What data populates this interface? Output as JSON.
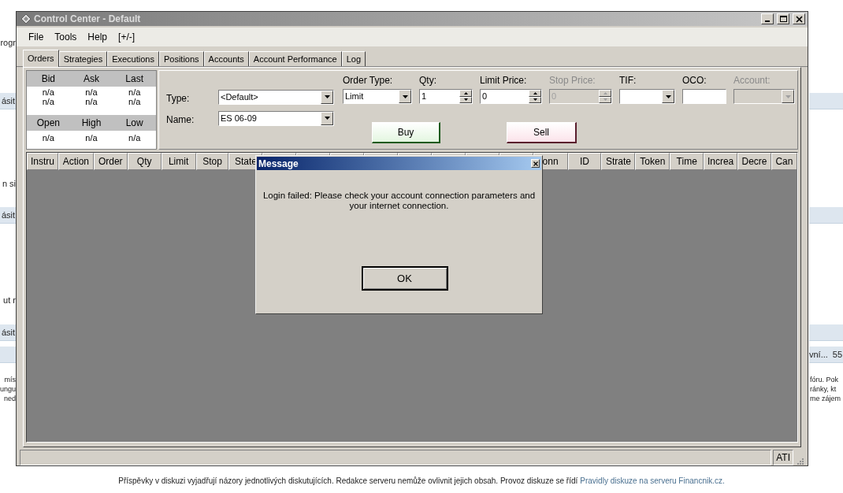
{
  "background_page": {
    "bars_left": [
      "ásit",
      "ásit",
      "ásit"
    ],
    "fragments_left": [
      "rogr",
      "n si",
      "ut r",
      "mís",
      "ungu",
      "ned"
    ],
    "bar_right": {
      "text": "vní...",
      "count": "55"
    },
    "fragments_right": [
      "fóru. Pok",
      "ránky, kt",
      "me zájem"
    ],
    "footer": {
      "text": "Příspěvky v diskuzi vyjadřují názory jednotlivých diskutujících. Redakce serveru nemůže ovlivnit jejich obsah. Provoz diskuze se řídí",
      "link": "Pravidly diskuze na serveru Financnik.cz."
    }
  },
  "window": {
    "title": "Control Center - Default"
  },
  "menu": [
    "File",
    "Tools",
    "Help",
    "[+/-]"
  ],
  "tabs": [
    {
      "label": "Orders",
      "selected": true
    },
    {
      "label": "Strategies",
      "selected": false
    },
    {
      "label": "Executions",
      "selected": false
    },
    {
      "label": "Positions",
      "selected": false
    },
    {
      "label": "Accounts",
      "selected": false
    },
    {
      "label": "Account Performance",
      "selected": false
    },
    {
      "label": "Log",
      "selected": false
    }
  ],
  "quote": [
    {
      "headers": [
        "Bid",
        "Ask",
        "Last"
      ],
      "rows": [
        [
          "n/a",
          "n/a",
          "n/a"
        ],
        [
          "n/a",
          "n/a",
          "n/a"
        ]
      ]
    },
    {
      "headers": [
        "Open",
        "High",
        "Low"
      ],
      "rows": [
        [
          "n/a",
          "n/a",
          "n/a"
        ]
      ]
    }
  ],
  "instrument": [
    {
      "label": "Type:",
      "value": "<Default>"
    },
    {
      "label": "Name:",
      "value": "ES 06-09"
    }
  ],
  "fields": [
    {
      "label": "Order Type:",
      "kind": "dropdown",
      "value": "Limit",
      "disabled": false
    },
    {
      "label": "Qty:",
      "kind": "spinner",
      "value": "1",
      "disabled": false
    },
    {
      "label": "Limit Price:",
      "kind": "spinner",
      "value": "0",
      "disabled": false
    },
    {
      "label": "Stop Price:",
      "kind": "spinner",
      "value": "0",
      "disabled": true
    },
    {
      "label": "TIF:",
      "kind": "dropdown",
      "disabled": false
    },
    {
      "label": "OCO:",
      "kind": "text",
      "disabled": false
    },
    {
      "label": "Account:",
      "kind": "dropdown",
      "disabled": true
    }
  ],
  "actions": [
    {
      "label": "Buy",
      "kind": "buy"
    },
    {
      "label": "Sell",
      "kind": "sell"
    }
  ],
  "grid": {
    "columns_left": [
      "Instru",
      "Action",
      "Order",
      "Qty",
      "Limit",
      "Stop",
      "State"
    ],
    "columns_right": [
      "onn",
      "ID",
      "Strate",
      "Token",
      "Time",
      "Increa",
      "Decre",
      "Can"
    ]
  },
  "status_bar": {
    "panel": "ATI"
  },
  "dialog": {
    "title": "Message",
    "message": "Login failed: Please check your account connection parameters and your internet connection.",
    "button": "OK"
  }
}
